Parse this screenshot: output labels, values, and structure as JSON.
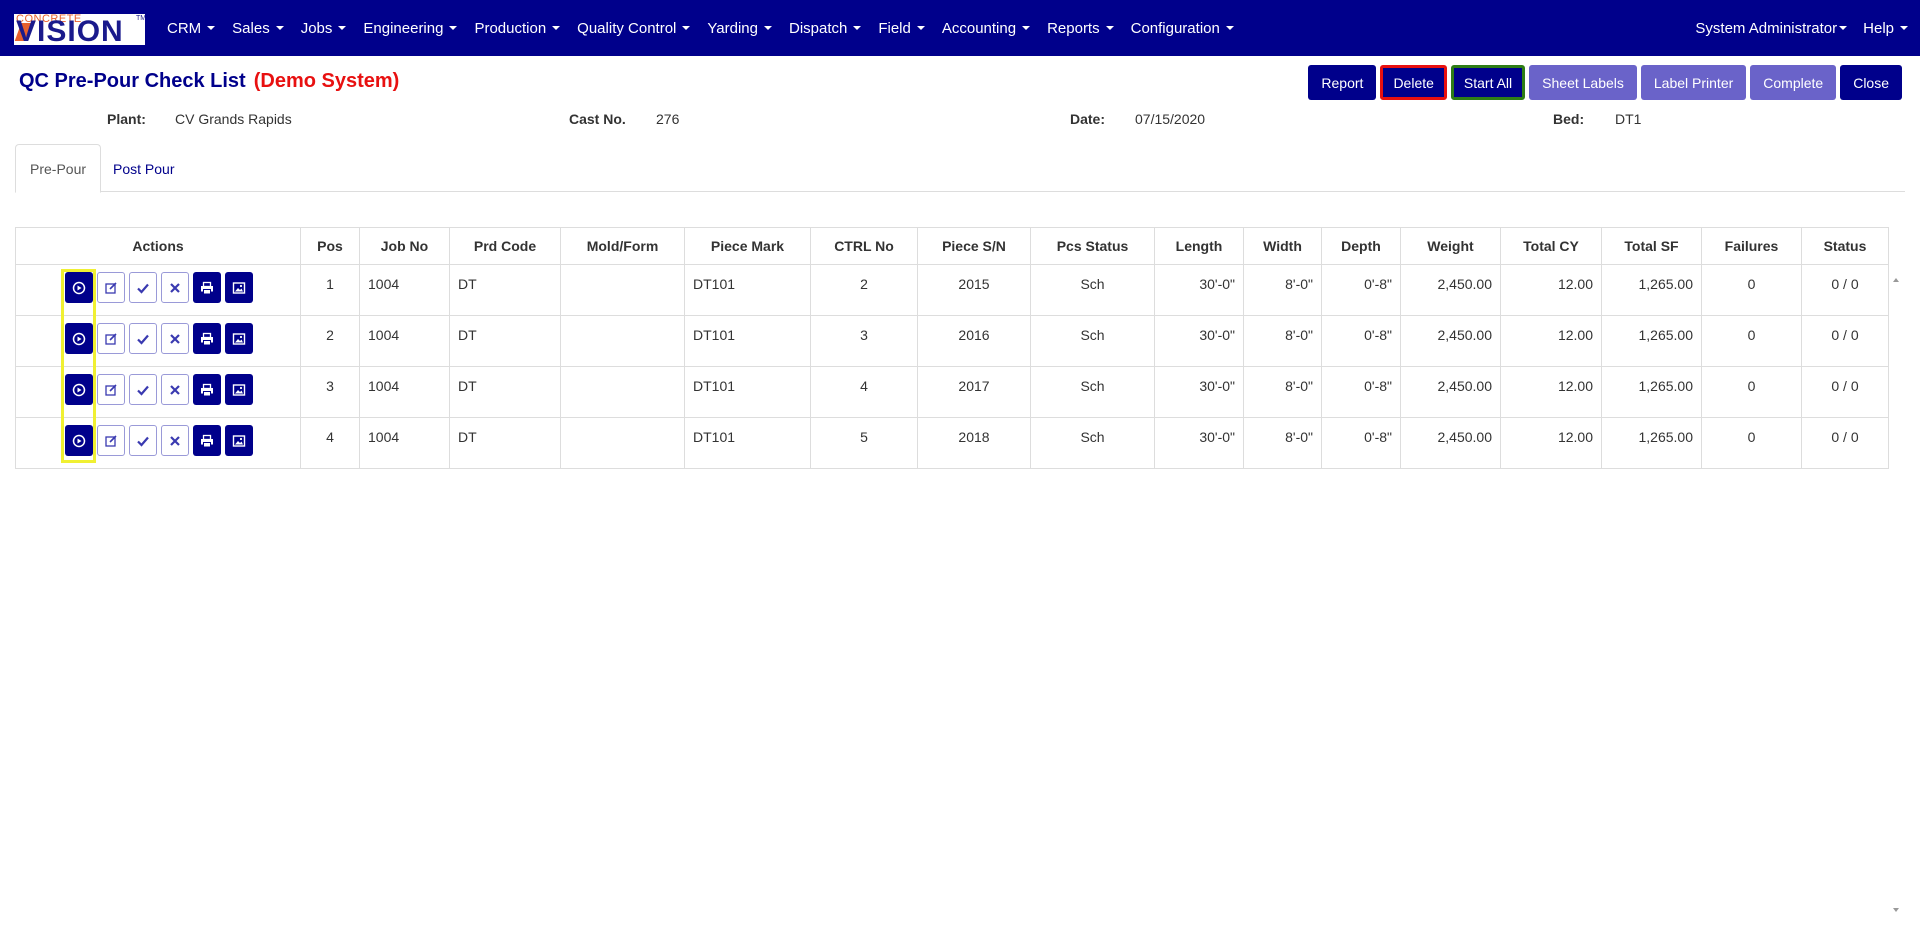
{
  "app": {
    "logo_small": "CONCRETE",
    "logo_big": "VISION",
    "logo_tm": "TM"
  },
  "nav": {
    "items": [
      {
        "label": "CRM"
      },
      {
        "label": "Sales"
      },
      {
        "label": "Jobs"
      },
      {
        "label": "Engineering"
      },
      {
        "label": "Production"
      },
      {
        "label": "Quality Control"
      },
      {
        "label": "Yarding"
      },
      {
        "label": "Dispatch"
      },
      {
        "label": "Field"
      },
      {
        "label": "Accounting"
      },
      {
        "label": "Reports"
      },
      {
        "label": "Configuration"
      }
    ],
    "user": "System Administrator",
    "help": "Help"
  },
  "page": {
    "title": "QC Pre-Pour Check List",
    "demo": "(Demo System)"
  },
  "buttons": {
    "report": "Report",
    "delete": "Delete",
    "start_all": "Start All",
    "sheet_labels": "Sheet Labels",
    "label_printer": "Label Printer",
    "complete": "Complete",
    "close": "Close"
  },
  "info": {
    "plant_label": "Plant:",
    "plant_value": "CV Grands Rapids",
    "cast_label": "Cast No.",
    "cast_value": "276",
    "date_label": "Date:",
    "date_value": "07/15/2020",
    "bed_label": "Bed:",
    "bed_value": "DT1"
  },
  "tabs": {
    "pre_pour": "Pre-Pour",
    "post_pour": "Post Pour"
  },
  "table": {
    "headers": {
      "actions": "Actions",
      "pos": "Pos",
      "job_no": "Job No",
      "prd_code": "Prd Code",
      "mold_form": "Mold/Form",
      "piece_mark": "Piece Mark",
      "ctrl_no": "CTRL No",
      "piece_sn": "Piece S/N",
      "pcs_status": "Pcs Status",
      "length": "Length",
      "width": "Width",
      "depth": "Depth",
      "weight": "Weight",
      "total_cy": "Total CY",
      "total_sf": "Total SF",
      "failures": "Failures",
      "status": "Status"
    },
    "rows": [
      {
        "pos": "1",
        "job_no": "1004",
        "prd_code": "DT",
        "mold_form": "",
        "piece_mark": "DT101",
        "ctrl_no": "2",
        "piece_sn": "2015",
        "pcs_status": "Sch",
        "length": "30'-0\"",
        "width": "8'-0\"",
        "depth": "0'-8\"",
        "weight": "2,450.00",
        "total_cy": "12.00",
        "total_sf": "1,265.00",
        "failures": "0",
        "status": "0 / 0"
      },
      {
        "pos": "2",
        "job_no": "1004",
        "prd_code": "DT",
        "mold_form": "",
        "piece_mark": "DT101",
        "ctrl_no": "3",
        "piece_sn": "2016",
        "pcs_status": "Sch",
        "length": "30'-0\"",
        "width": "8'-0\"",
        "depth": "0'-8\"",
        "weight": "2,450.00",
        "total_cy": "12.00",
        "total_sf": "1,265.00",
        "failures": "0",
        "status": "0 / 0"
      },
      {
        "pos": "3",
        "job_no": "1004",
        "prd_code": "DT",
        "mold_form": "",
        "piece_mark": "DT101",
        "ctrl_no": "4",
        "piece_sn": "2017",
        "pcs_status": "Sch",
        "length": "30'-0\"",
        "width": "8'-0\"",
        "depth": "0'-8\"",
        "weight": "2,450.00",
        "total_cy": "12.00",
        "total_sf": "1,265.00",
        "failures": "0",
        "status": "0 / 0"
      },
      {
        "pos": "4",
        "job_no": "1004",
        "prd_code": "DT",
        "mold_form": "",
        "piece_mark": "DT101",
        "ctrl_no": "5",
        "piece_sn": "2018",
        "pcs_status": "Sch",
        "length": "30'-0\"",
        "width": "8'-0\"",
        "depth": "0'-8\"",
        "weight": "2,450.00",
        "total_cy": "12.00",
        "total_sf": "1,265.00",
        "failures": "0",
        "status": "0 / 0"
      }
    ],
    "row_actions": [
      "play-icon",
      "edit-icon",
      "check-icon",
      "x-icon",
      "print-icon",
      "image-icon"
    ]
  },
  "colors": {
    "navbar": "#00008b",
    "button_dark": "#00008b",
    "button_light": "#6a63c9",
    "demo_red": "#e81010",
    "highlight_red": "#e81010",
    "highlight_green": "#2e7d16",
    "highlight_yellow": "#f0f032"
  }
}
